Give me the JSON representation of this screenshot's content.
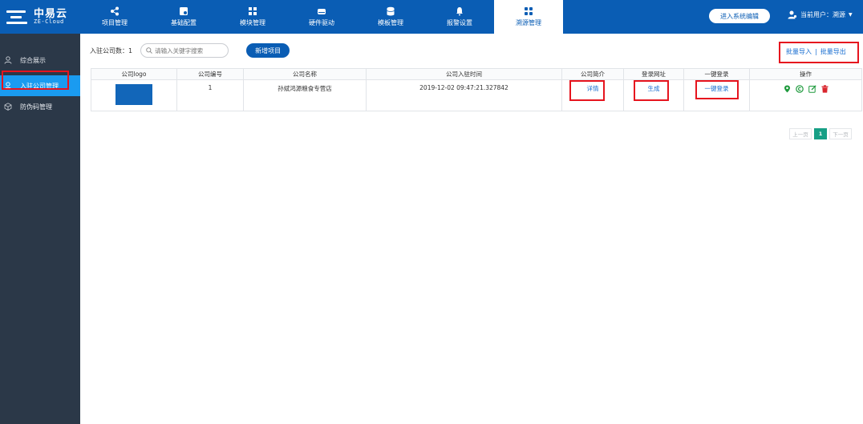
{
  "brand": {
    "cn": "中易云",
    "en": "ZE-Cloud"
  },
  "nav": [
    {
      "label": "项目管理",
      "icon": "share-icon"
    },
    {
      "label": "基础配置",
      "icon": "config-icon"
    },
    {
      "label": "模块管理",
      "icon": "modules-icon"
    },
    {
      "label": "硬件驱动",
      "icon": "drive-icon"
    },
    {
      "label": "模板管理",
      "icon": "database-icon"
    },
    {
      "label": "报警设置",
      "icon": "bell-icon"
    },
    {
      "label": "溯源管理",
      "icon": "grid-icon",
      "active": true
    }
  ],
  "header": {
    "system_button": "进入系统编辑",
    "user": "当前用户：溯源"
  },
  "sidebar": {
    "items": [
      {
        "label": "综合展示",
        "icon": "user-icon"
      },
      {
        "label": "入驻公司管理",
        "icon": "user-icon",
        "active": true
      },
      {
        "label": "防伪码管理",
        "icon": "cube-icon"
      }
    ]
  },
  "toolbar": {
    "count_label": "入驻公司数：",
    "count": "1",
    "search_placeholder": "请输入关键字搜索",
    "add_button": "新增项目",
    "batch_import": "批量导入",
    "batch_export": "批量导出",
    "separator": "|"
  },
  "table": {
    "columns": [
      "公司logo",
      "公司编号",
      "公司名称",
      "公司入驻时间",
      "公司简介",
      "登录网址",
      "一键登录",
      "操作"
    ],
    "rows": [
      {
        "id": "1",
        "name": "孙斌鸿源粮食专营店",
        "joined": "2019-12-02 09:47:21.327842",
        "intro": "详情",
        "url": "生成",
        "login": "一键登录"
      }
    ]
  },
  "pager": {
    "prev": "上一页",
    "current": "1",
    "next": "下一页"
  },
  "colors": {
    "primary": "#0a5db4",
    "sidebar": "#2b3848",
    "sidebar_active": "#1a9bf0",
    "highlight": "#e6141e",
    "pager_active": "#169f85"
  }
}
